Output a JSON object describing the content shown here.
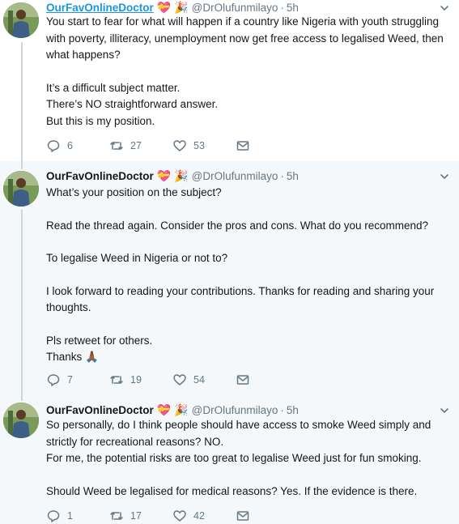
{
  "tweets": [
    {
      "name": "OurFavOnlineDoctor",
      "emoji_1": "💝",
      "emoji_2": "🎉",
      "handle": "@DrOlufunmilayo",
      "dot": "·",
      "time": "5h",
      "paragraphs": [
        "You start to fear for what will happen if a country like Nigeria with youth struggling with poverty, illiteracy, unemployment now get free access to legalised Weed, then what happens?",
        "It’s a difficult subject matter.\nThere’s NO straightforward answer.\nBut this is my position."
      ],
      "replies": "6",
      "retweets": "27",
      "likes": "53"
    },
    {
      "name": "OurFavOnlineDoctor",
      "emoji_1": "💝",
      "emoji_2": "🎉",
      "handle": "@DrOlufunmilayo",
      "dot": "·",
      "time": "5h",
      "paragraphs": [
        "What’s your position on the subject?",
        "Read the thread again. Consider the pros and cons. What do you recommend?",
        "To legalise Weed in Nigeria or not to?",
        "I look forward to reading your contributions. Thanks for reading and sharing your thoughts.",
        "Pls retweet for others.\nThanks 🙏🏾"
      ],
      "replies": "7",
      "retweets": "19",
      "likes": "54"
    },
    {
      "name": "OurFavOnlineDoctor",
      "emoji_1": "💝",
      "emoji_2": "🎉",
      "handle": "@DrOlufunmilayo",
      "dot": "·",
      "time": "5h",
      "paragraphs": [
        "So personally, do I think people should have access to smoke Weed simply and strictly for recreational reasons? NO.\nFor me, the potential risks are too great to legalise Weed just for fun smoking.",
        "Should Weed be legalised for medical reasons? Yes. If the evidence is there."
      ],
      "replies": "1",
      "retweets": "17",
      "likes": "42"
    }
  ],
  "icons": {
    "reply": "reply-icon",
    "retweet": "retweet-icon",
    "like": "heart-icon",
    "message": "envelope-icon",
    "caret": "chevron-down-icon"
  },
  "colors": {
    "link": "#1b95e0",
    "muted": "#657786",
    "thread_line": "#ccd6dd"
  }
}
